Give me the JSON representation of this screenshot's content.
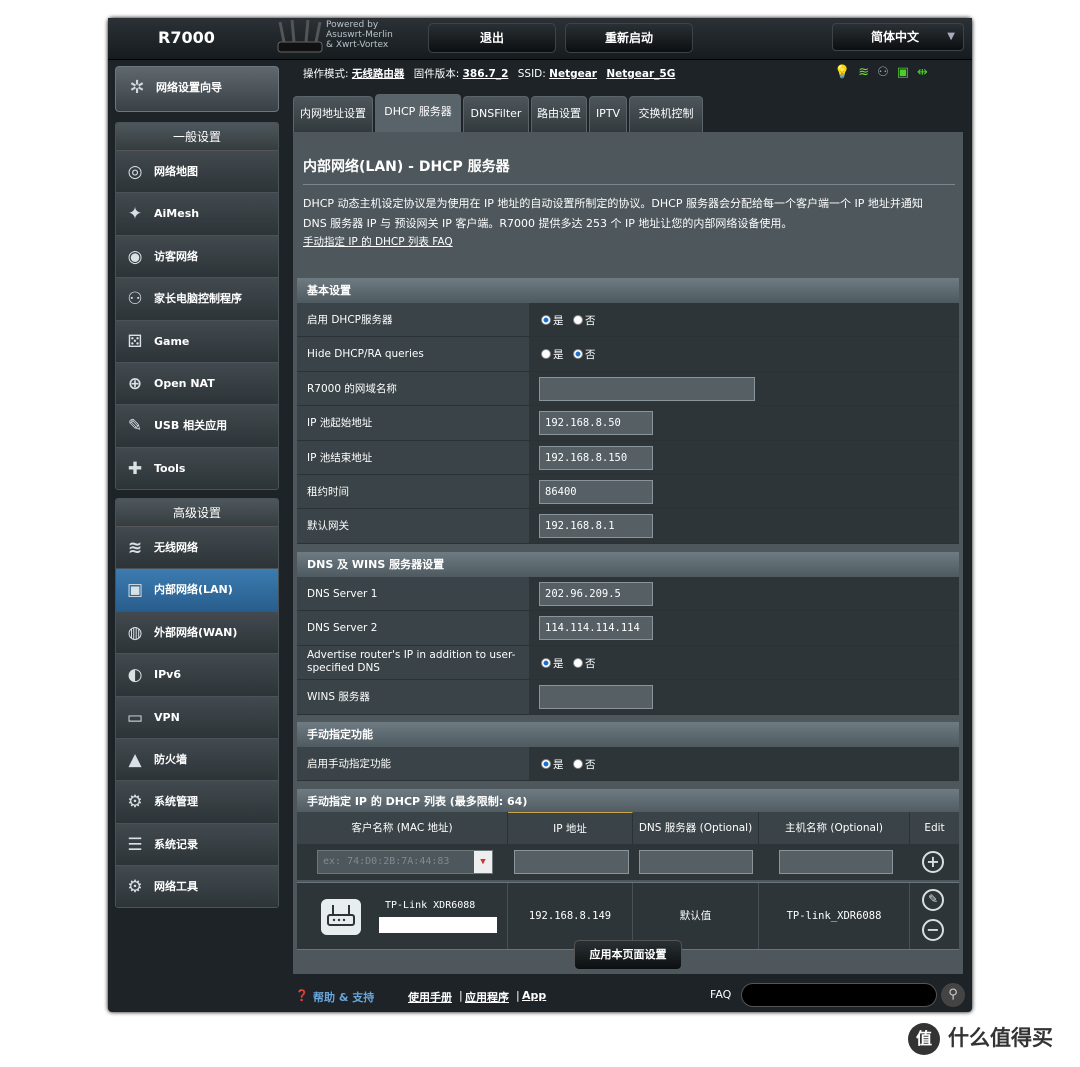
{
  "header": {
    "model": "R7000",
    "powered_by": [
      "Powered by",
      "Asuswrt-Merlin",
      "& Xwrt-Vortex"
    ],
    "logout": "退出",
    "reboot": "重新启动",
    "language": "简体中文"
  },
  "status": {
    "mode_label": "操作模式:",
    "mode_value": "无线路由器",
    "firmware_label": "固件版本:",
    "firmware_value": "386.7_2",
    "ssid_label": "SSID:",
    "ssid_1": "Netgear",
    "ssid_2": "Netgear_5G"
  },
  "sidebar": {
    "wizard": "网络设置向导",
    "general_title": "一般设置",
    "general": [
      {
        "label": "网络地图",
        "icon": "network-map-icon",
        "glyph": "◎"
      },
      {
        "label": "AiMesh",
        "icon": "aimesh-icon",
        "glyph": "✦"
      },
      {
        "label": "访客网络",
        "icon": "guest-network-icon",
        "glyph": "◉"
      },
      {
        "label": "家长电脑控制程序",
        "icon": "parental-control-icon",
        "glyph": "⚇"
      },
      {
        "label": "Game",
        "icon": "game-icon",
        "glyph": "⚄"
      },
      {
        "label": "Open NAT",
        "icon": "open-nat-icon",
        "glyph": "⊕"
      },
      {
        "label": "USB 相关应用",
        "icon": "usb-icon",
        "glyph": "✎"
      },
      {
        "label": "Tools",
        "icon": "tools-icon",
        "glyph": "✚"
      }
    ],
    "advanced_title": "高级设置",
    "advanced": [
      {
        "label": "无线网络",
        "icon": "wireless-icon",
        "glyph": "≋"
      },
      {
        "label": "内部网络(LAN)",
        "icon": "lan-icon",
        "glyph": "▣",
        "active": true
      },
      {
        "label": "外部网络(WAN)",
        "icon": "wan-icon",
        "glyph": "◍"
      },
      {
        "label": "IPv6",
        "icon": "ipv6-icon",
        "glyph": "◐"
      },
      {
        "label": "VPN",
        "icon": "vpn-icon",
        "glyph": "▭"
      },
      {
        "label": "防火墙",
        "icon": "firewall-icon",
        "glyph": "▲"
      },
      {
        "label": "系统管理",
        "icon": "admin-icon",
        "glyph": "⚙"
      },
      {
        "label": "系统记录",
        "icon": "log-icon",
        "glyph": "☰"
      },
      {
        "label": "网络工具",
        "icon": "network-tools-icon",
        "glyph": "⚙"
      }
    ]
  },
  "tabs": [
    "内网地址设置",
    "DHCP 服务器",
    "DNSFilter",
    "路由设置",
    "IPTV",
    "交换机控制"
  ],
  "page": {
    "title": "内部网络(LAN) - DHCP 服务器",
    "desc1": "DHCP 动态主机设定协议是为使用在 IP 地址的自动设置所制定的协议。DHCP 服务器会分配给每一个客户端一个 IP 地址并通知",
    "desc2": "DNS 服务器 IP 与 预设网关 IP 客户端。R7000 提供多达 253 个 IP 地址让您的内部网络设备使用。",
    "faq": "手动指定 IP 的 DHCP 列表 FAQ"
  },
  "basic": {
    "title": "基本设置",
    "enable_dhcp": "启用 DHCP服务器",
    "hide_dhcp": "Hide DHCP/RA queries",
    "domain": "R7000 的网域名称",
    "domain_value": "",
    "ip_start": "IP 池起始地址",
    "ip_start_value": "192.168.8.50",
    "ip_end": "IP 池结束地址",
    "ip_end_value": "192.168.8.150",
    "lease": "租约时间",
    "lease_value": "86400",
    "gateway": "默认网关",
    "gateway_value": "192.168.8.1"
  },
  "radio": {
    "yes": "是",
    "no": "否"
  },
  "dns": {
    "title": "DNS 及 WINS 服务器设置",
    "dns1": "DNS Server 1",
    "dns1_value": "202.96.209.5",
    "dns2": "DNS Server 2",
    "dns2_value": "114.114.114.114",
    "advertise": "Advertise router's IP in addition to user-specified DNS",
    "wins": "WINS 服务器",
    "wins_value": ""
  },
  "manual": {
    "title": "手动指定功能",
    "enable": "启用手动指定功能"
  },
  "list": {
    "title": "手动指定 IP 的 DHCP 列表 (最多限制: 64)",
    "col_client": "客户名称 (MAC 地址)",
    "col_ip": "IP 地址",
    "col_dns": "DNS 服务器 (Optional)",
    "col_host": "主机名称 (Optional)",
    "col_edit": "Edit",
    "mac_placeholder": "ex: 74:D0:2B:7A:44:83",
    "entry_name": "TP-Link XDR6088",
    "entry_ip": "192.168.8.149",
    "entry_dns": "默认值",
    "entry_host": "TP-link_XDR6088"
  },
  "apply": "应用本页面设置",
  "footer": {
    "help": "帮助 & 支持",
    "manual": "使用手册",
    "utility": "应用程序",
    "app": "App",
    "faq": "FAQ"
  },
  "watermark": "什么值得买"
}
